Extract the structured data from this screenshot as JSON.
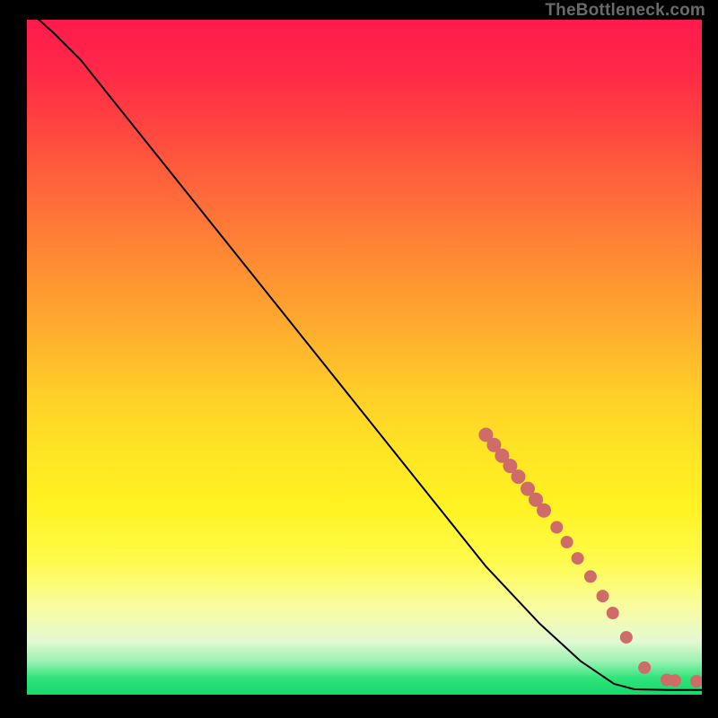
{
  "attribution": "TheBottleneck.com",
  "chart_data": {
    "type": "line",
    "title": "",
    "xlabel": "",
    "ylabel": "",
    "xlim": [
      0,
      100
    ],
    "ylim": [
      0,
      100
    ],
    "grid": false,
    "legend": false,
    "curve": [
      {
        "x": 0,
        "y": 101.6
      },
      {
        "x": 4,
        "y": 98
      },
      {
        "x": 8,
        "y": 94
      },
      {
        "x": 12,
        "y": 89
      },
      {
        "x": 20,
        "y": 79
      },
      {
        "x": 30,
        "y": 66.5
      },
      {
        "x": 40,
        "y": 54
      },
      {
        "x": 50,
        "y": 41.5
      },
      {
        "x": 60,
        "y": 29
      },
      {
        "x": 68,
        "y": 19
      },
      {
        "x": 76,
        "y": 10.5
      },
      {
        "x": 82,
        "y": 5
      },
      {
        "x": 87,
        "y": 1.6
      },
      {
        "x": 90,
        "y": 0.8
      },
      {
        "x": 95,
        "y": 0.7
      },
      {
        "x": 100,
        "y": 0.7
      }
    ],
    "dots": [
      {
        "x": 68.0,
        "y": 38.5,
        "r": 8
      },
      {
        "x": 69.2,
        "y": 37.0,
        "r": 8
      },
      {
        "x": 70.4,
        "y": 35.4,
        "r": 8
      },
      {
        "x": 71.6,
        "y": 33.9,
        "r": 8
      },
      {
        "x": 72.8,
        "y": 32.3,
        "r": 8
      },
      {
        "x": 74.2,
        "y": 30.5,
        "r": 8
      },
      {
        "x": 75.4,
        "y": 28.9,
        "r": 8
      },
      {
        "x": 76.6,
        "y": 27.3,
        "r": 8
      },
      {
        "x": 78.5,
        "y": 24.8,
        "r": 7
      },
      {
        "x": 80.0,
        "y": 22.6,
        "r": 7
      },
      {
        "x": 81.6,
        "y": 20.2,
        "r": 7
      },
      {
        "x": 83.5,
        "y": 17.5,
        "r": 7
      },
      {
        "x": 85.3,
        "y": 14.6,
        "r": 7
      },
      {
        "x": 86.8,
        "y": 12.1,
        "r": 7
      },
      {
        "x": 88.8,
        "y": 8.5,
        "r": 7
      },
      {
        "x": 91.5,
        "y": 4.0,
        "r": 7
      },
      {
        "x": 94.8,
        "y": 2.2,
        "r": 7
      },
      {
        "x": 96.0,
        "y": 2.1,
        "r": 7
      },
      {
        "x": 99.2,
        "y": 2.0,
        "r": 7
      }
    ],
    "colors": {
      "curve": "#000000",
      "dots": "#cf6b68",
      "gradient_top": "#ff1a4d",
      "gradient_bottom": "#14d96b"
    }
  }
}
